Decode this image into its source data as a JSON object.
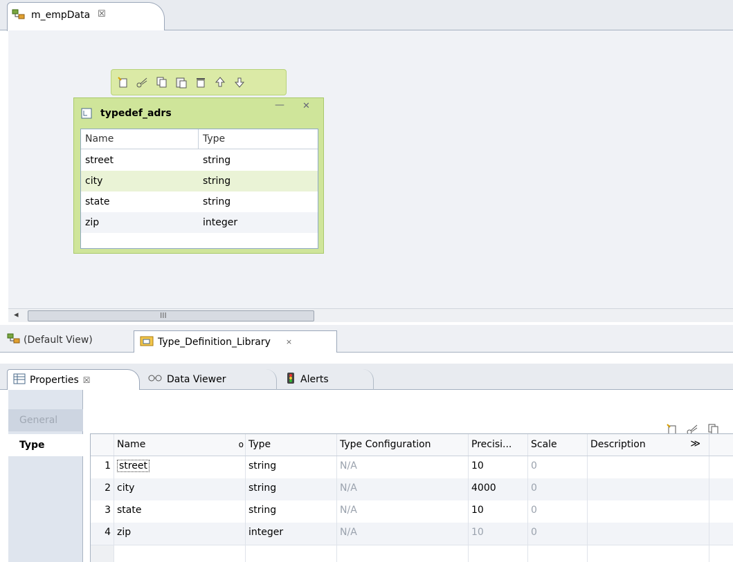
{
  "editor": {
    "tab_label": "m_empData",
    "tab_close": "☒"
  },
  "object_toolbar": {
    "icons": [
      "new-field-icon",
      "cut-icon",
      "copy-icon",
      "paste-icon",
      "delete-icon",
      "move-up-icon",
      "move-down-icon"
    ]
  },
  "typedef": {
    "title": "typedef_adrs",
    "columns": [
      "Name",
      "Type"
    ],
    "rows": [
      {
        "name": "street",
        "type": "string"
      },
      {
        "name": "city",
        "type": "string"
      },
      {
        "name": "state",
        "type": "string"
      },
      {
        "name": "zip",
        "type": "integer"
      }
    ]
  },
  "scrollbar": {
    "left_arrow": "◂",
    "grip": "III"
  },
  "view_tabs": {
    "default_label": "(Default View)",
    "type_library_label": "Type_Definition_Library",
    "close": "×"
  },
  "panel_tabs": {
    "properties": "Properties",
    "properties_close": "☒",
    "data_viewer": "Data Viewer",
    "alerts": "Alerts"
  },
  "sidenav": {
    "general": "General",
    "type": "Type"
  },
  "grid": {
    "columns": [
      "Name",
      "Type",
      "Type Configuration",
      "Precisi...",
      "Scale",
      "Description"
    ],
    "more_marker": "≫",
    "sort_marker": "o",
    "rows": [
      {
        "num": "1",
        "name": "street",
        "type": "string",
        "config": "N/A",
        "precision": "10",
        "scale": "0",
        "description": ""
      },
      {
        "num": "2",
        "name": "city",
        "type": "string",
        "config": "N/A",
        "precision": "4000",
        "scale": "0",
        "description": ""
      },
      {
        "num": "3",
        "name": "state",
        "type": "string",
        "config": "N/A",
        "precision": "10",
        "scale": "0",
        "description": ""
      },
      {
        "num": "4",
        "name": "zip",
        "type": "integer",
        "config": "N/A",
        "precision": "10",
        "scale": "0",
        "description": ""
      }
    ]
  },
  "colors": {
    "box_fill": "#cfe59a",
    "selected_row": "#eaf3d6",
    "canvas": "#f0f2f6",
    "nav_bg": "#dfe5ee"
  }
}
